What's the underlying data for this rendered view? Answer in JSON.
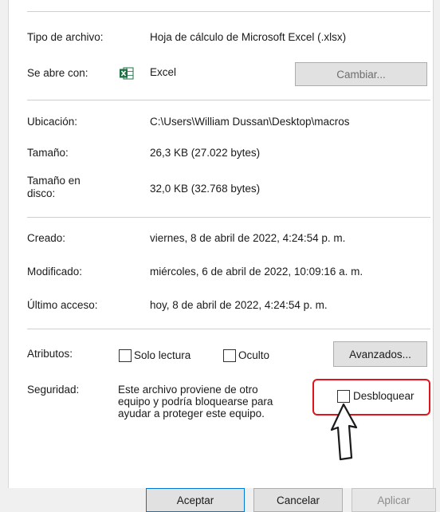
{
  "properties": {
    "file_type_label": "Tipo de archivo:",
    "file_type_value": "Hoja de cálculo de Microsoft Excel (.xlsx)",
    "opens_with_label": "Se abre con:",
    "opens_with_value": "Excel",
    "change_button": "Cambiar...",
    "location_label": "Ubicación:",
    "location_value": "C:\\Users\\William Dussan\\Desktop\\macros",
    "size_label": "Tamaño:",
    "size_value": "26,3 KB (27.022 bytes)",
    "size_on_disk_label": "Tamaño en disco:",
    "size_on_disk_label_line1": "Tamaño en",
    "size_on_disk_label_line2": "disco:",
    "size_on_disk_value": "32,0 KB (32.768 bytes)",
    "created_label": "Creado:",
    "created_value": "viernes, 8 de abril de 2022, 4:24:54 p. m.",
    "modified_label": "Modificado:",
    "modified_value": "miércoles, 6 de abril de 2022, 10:09:16 a. m.",
    "accessed_label": "Último acceso:",
    "accessed_value": "hoy, 8 de abril de 2022, 4:24:54 p. m.",
    "attributes_label": "Atributos:",
    "readonly_label": "Solo lectura",
    "hidden_label": "Oculto",
    "advanced_button": "Avanzados...",
    "security_label": "Seguridad:",
    "security_line1": "Este archivo proviene de otro",
    "security_line2": "equipo y podría bloquearse para",
    "security_line3": "ayudar a proteger este equipo.",
    "unblock_label": "Desbloquear"
  },
  "footer": {
    "ok_button": "Aceptar",
    "cancel_button": "Cancelar",
    "apply_button": "Aplicar"
  },
  "colors": {
    "highlight": "#e1141e",
    "excel_green": "#1e7145"
  },
  "icons": {
    "excel": "excel-icon",
    "arrow": "pointer-arrow-annotation"
  }
}
